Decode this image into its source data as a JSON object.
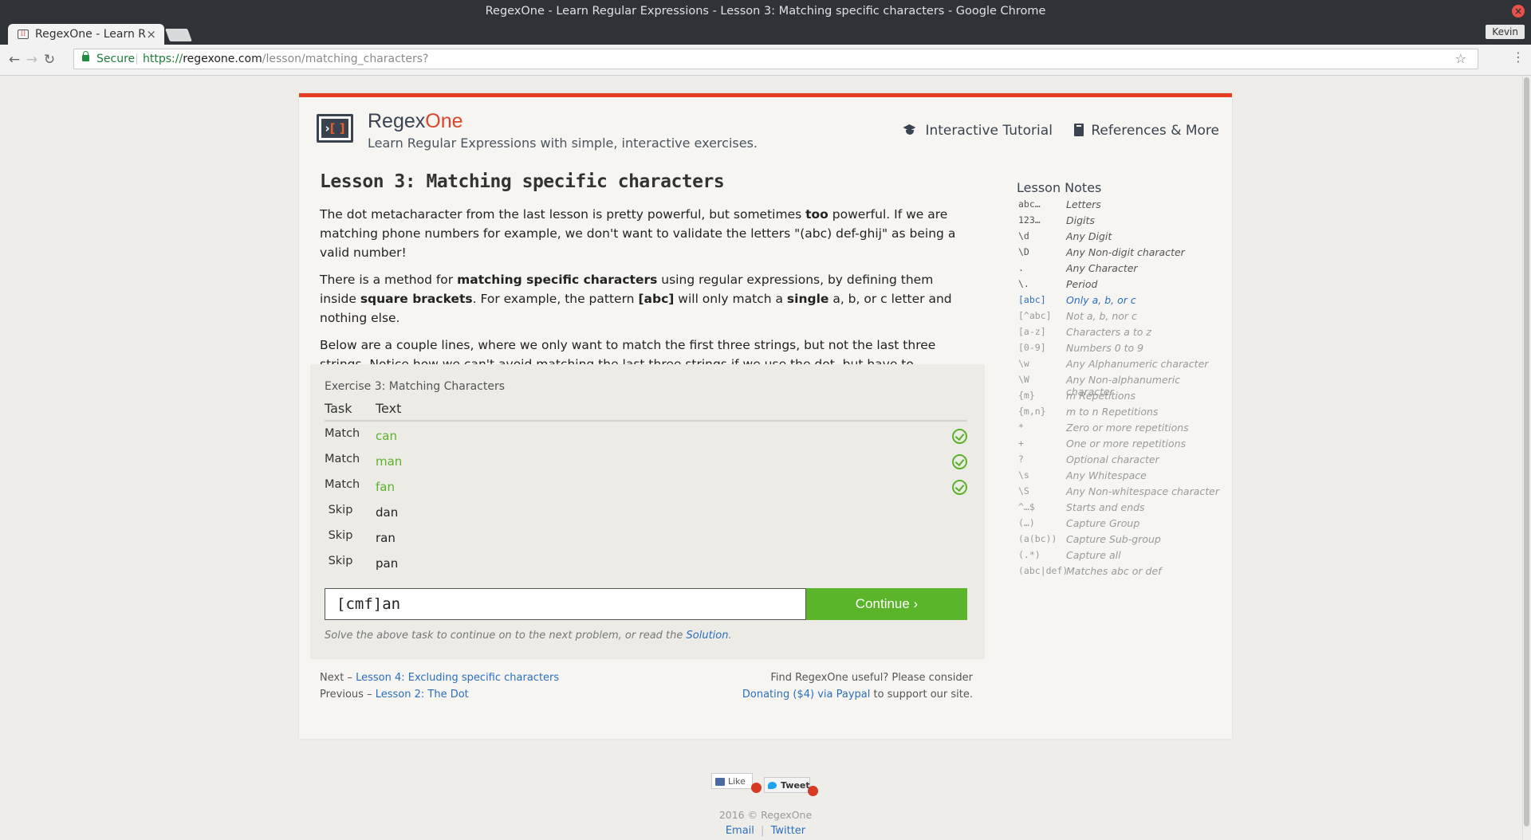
{
  "window": {
    "title": "RegexOne - Learn Regular Expressions - Lesson 3: Matching specific characters - Google Chrome",
    "profile": "Kevin"
  },
  "tab": {
    "title": "RegexOne - Learn R"
  },
  "omnibox": {
    "secure_label": "Secure",
    "scheme": "https://",
    "host": "regexone.com",
    "path": "/lesson/matching_characters?"
  },
  "header": {
    "brand_main": "Regex",
    "brand_accent": "One",
    "tagline": "Learn Regular Expressions with simple, interactive exercises.",
    "nav": [
      "Interactive Tutorial",
      "References & More"
    ]
  },
  "lesson": {
    "title": "Lesson 3: Matching specific characters",
    "p1_a": "The dot metacharacter from the last lesson is pretty powerful, but sometimes ",
    "p1_b": "too",
    "p1_c": " powerful. If we are matching phone numbers for example, we don't want to validate the letters \"(abc) def-ghij\" as being a valid number!",
    "p2_a": "There is a method for ",
    "p2_b": "matching specific characters",
    "p2_c": " using regular expressions, by defining them inside ",
    "p2_d": "square brackets",
    "p2_e": ". For example, the pattern ",
    "p2_f": "[abc]",
    "p2_g": " will only match a ",
    "p2_h": "single",
    "p2_i": " a, b, or c letter and nothing else.",
    "p3": "Below are a couple lines, where we only want to match the first three strings, but not the last three strings. Notice how we can't avoid matching the last three strings if we use the dot, but have to specifically define what letters to match using the notation above."
  },
  "exercise": {
    "title": "Exercise 3: Matching Characters",
    "col_task": "Task",
    "col_text": "Text",
    "rows": [
      {
        "task": "Match",
        "text": "can"
      },
      {
        "task": "Match",
        "text": "man"
      },
      {
        "task": "Match",
        "text": "fan"
      },
      {
        "task": "Skip",
        "text": "dan"
      },
      {
        "task": "Skip",
        "text": "ran"
      },
      {
        "task": "Skip",
        "text": "pan"
      }
    ],
    "input_value": "[cmf]an",
    "continue_label": "Continue ›",
    "hint_a": "Solve the above task to continue on to the next problem, or read the ",
    "hint_link": "Solution",
    "hint_b": "."
  },
  "footer_nav": {
    "next_label": "Next – ",
    "next_link": "Lesson 4: Excluding specific characters",
    "prev_label": "Previous – ",
    "prev_link": "Lesson 2: The Dot",
    "donate_a": "Find RegexOne useful? Please consider",
    "donate_link": "Donating ($4) via Paypal",
    "donate_b": " to support our site."
  },
  "notes": {
    "title": "Lesson Notes",
    "items": [
      {
        "k": "abc…",
        "v": "Letters"
      },
      {
        "k": "123…",
        "v": "Digits"
      },
      {
        "k": "\\d",
        "v": "Any Digit"
      },
      {
        "k": "\\D",
        "v": "Any Non-digit character"
      },
      {
        "k": ".",
        "v": "Any Character"
      },
      {
        "k": "\\.",
        "v": "Period"
      },
      {
        "k": "[abc]",
        "v": "Only a, b, or c"
      },
      {
        "k": "[^abc]",
        "v": "Not a, b, nor c"
      },
      {
        "k": "[a-z]",
        "v": "Characters a to z"
      },
      {
        "k": "[0-9]",
        "v": "Numbers 0 to 9"
      },
      {
        "k": "\\w",
        "v": "Any Alphanumeric character"
      },
      {
        "k": "\\W",
        "v": "Any Non-alphanumeric character"
      },
      {
        "k": "{m}",
        "v": "m Repetitions"
      },
      {
        "k": "{m,n}",
        "v": "m to n Repetitions"
      },
      {
        "k": "*",
        "v": "Zero or more repetitions"
      },
      {
        "k": "+",
        "v": "One or more repetitions"
      },
      {
        "k": "?",
        "v": "Optional character"
      },
      {
        "k": "\\s",
        "v": "Any Whitespace"
      },
      {
        "k": "\\S",
        "v": "Any Non-whitespace character"
      },
      {
        "k": "^…$",
        "v": "Starts and ends"
      },
      {
        "k": "(…)",
        "v": "Capture Group"
      },
      {
        "k": "(a(bc))",
        "v": "Capture Sub-group"
      },
      {
        "k": "(.*)",
        "v": "Capture all"
      },
      {
        "k": "(abc|def)",
        "v": "Matches abc or def"
      }
    ]
  },
  "social": {
    "like": "Like",
    "tweet": "Tweet"
  },
  "site_footer": {
    "copyright": "2016 © RegexOne",
    "email": "Email",
    "divider": "|",
    "twitter": "Twitter"
  }
}
